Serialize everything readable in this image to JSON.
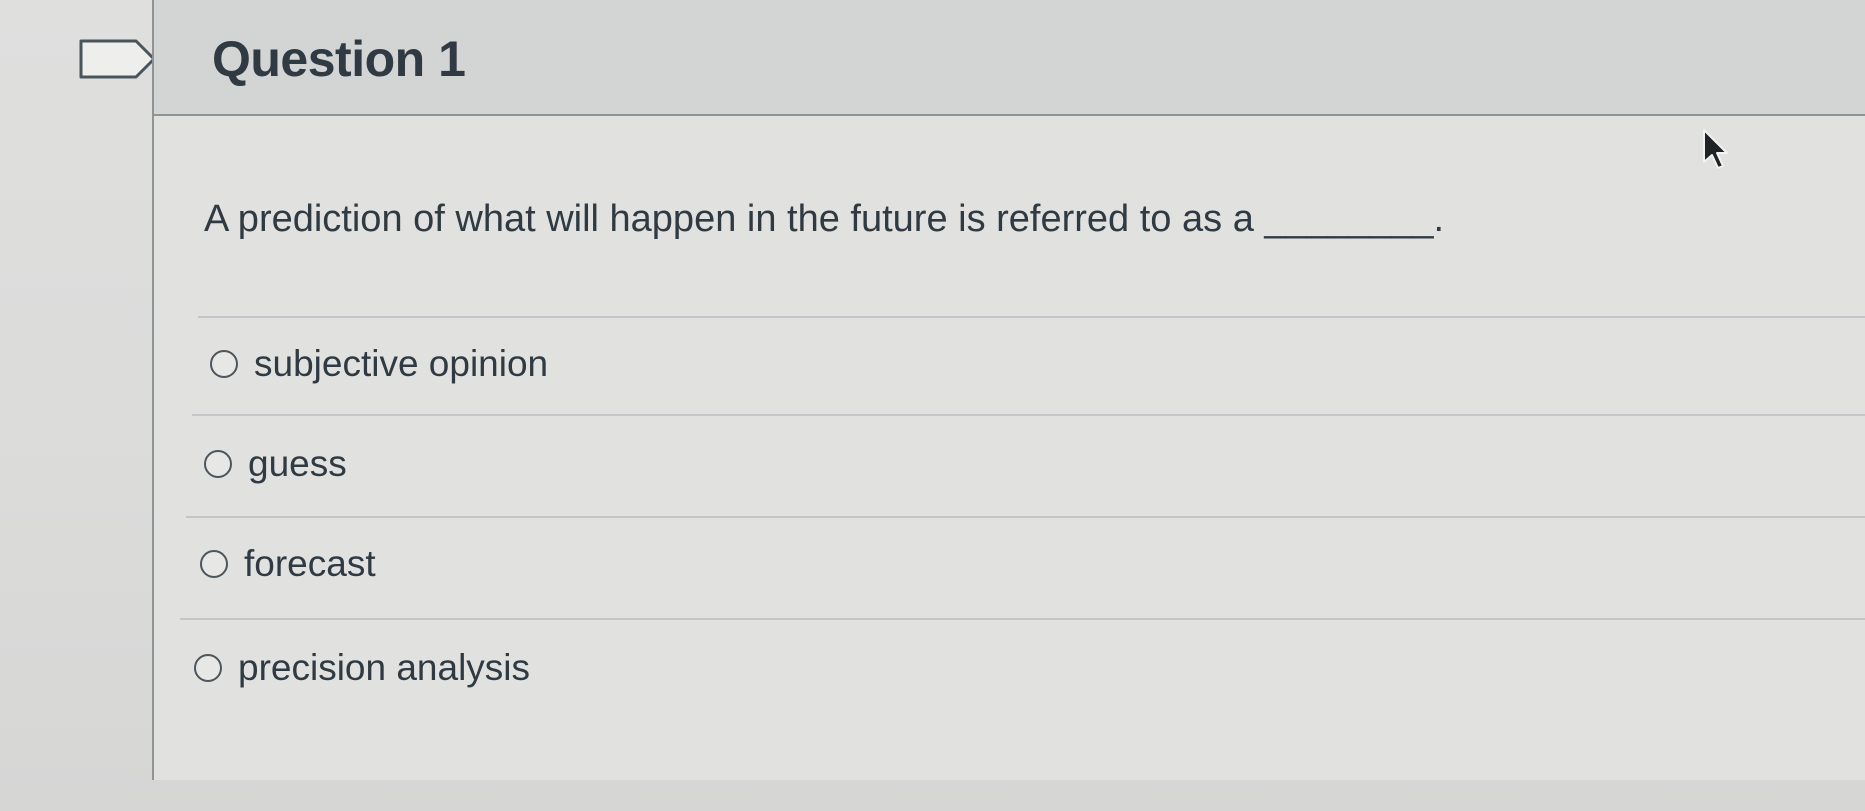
{
  "question": {
    "title": "Question 1",
    "prompt": "A prediction of what will happen in the future is referred to as a ________."
  },
  "answers": [
    {
      "label": "subjective opinion",
      "selected": false
    },
    {
      "label": "guess",
      "selected": false
    },
    {
      "label": "forecast",
      "selected": false
    },
    {
      "label": "precision analysis",
      "selected": false
    }
  ],
  "icons": {
    "flag": "flag-question-icon",
    "cursor": "mouse-pointer-icon"
  },
  "colors": {
    "text": "#2f3a42",
    "header_bg": "#d3d4d4",
    "border": "#8f9496"
  }
}
